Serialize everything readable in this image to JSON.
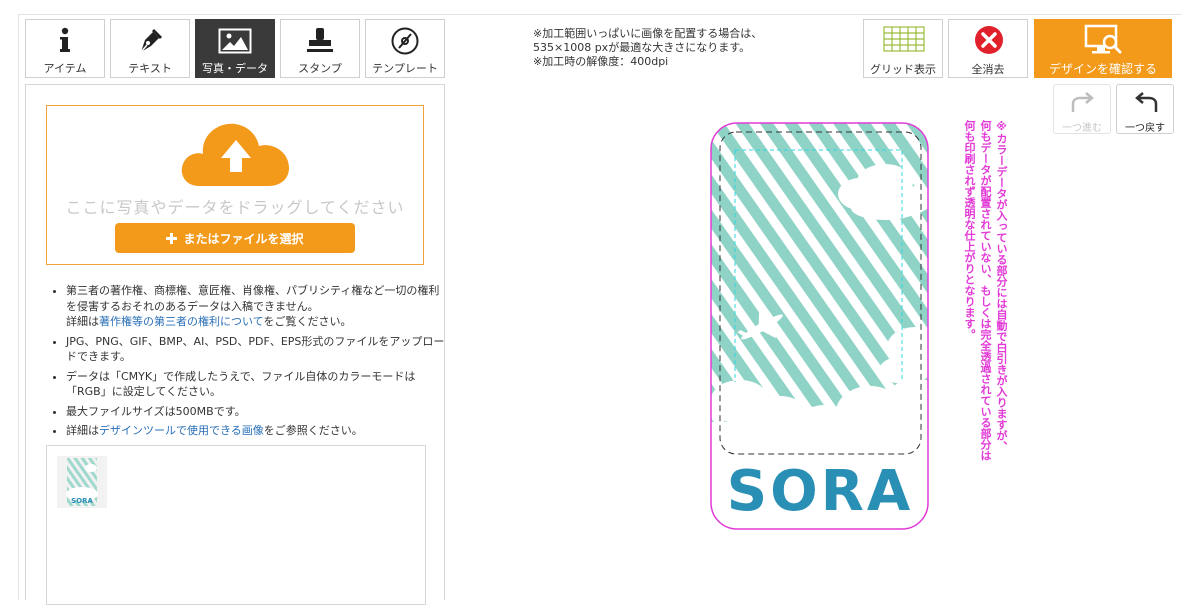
{
  "tabs": [
    {
      "label": "アイテム",
      "icon": "info-icon"
    },
    {
      "label": "テキスト",
      "icon": "pen-nib-icon"
    },
    {
      "label": "写真・データ",
      "icon": "image-icon"
    },
    {
      "label": "スタンプ",
      "icon": "stamp-icon"
    },
    {
      "label": "テンプレート",
      "icon": "template-icon"
    }
  ],
  "active_tab": "写真・データ",
  "upload": {
    "drop_text": "ここに写真やデータをドラッグしてください",
    "select_button": "またはファイルを選択"
  },
  "notes": {
    "n1_a": "第三者の著作権、商標権、意匠権、肖像権、パブリシティ権など一切の権利を侵害するおそれのあるデータは入稿できません。",
    "n1_b": "詳細は",
    "n1_link": "著作権等の第三者の権利について",
    "n1_c": "をご覧ください。",
    "n2": "JPG、PNG、GIF、BMP、AI、PSD、PDF、EPS形式のファイルをアップロードできます。",
    "n3": "データは「CMYK」で作成したうえで、ファイル自体のカラーモードは「RGB」に設定してください。",
    "n4": "最大ファイルサイズは500MBです。",
    "n5_a": "詳細は",
    "n5_link": "デザインツールで使用できる画像",
    "n5_b": "をご参照ください。"
  },
  "info": {
    "line1": "※加工範囲いっぱいに画像を配置する場合は、",
    "line2": "535×1008 pxが最適な大きさになります。",
    "line3": "※加工時の解像度：400dpi"
  },
  "toolbar": {
    "grid_label": "グリッド表示",
    "clear_label": "全消去",
    "confirm_label": "デザインを確認する",
    "redo_label": "一つ進む",
    "undo_label": "一つ戻す"
  },
  "canvas": {
    "design_text": "SORA",
    "thumb_text": "SORA"
  },
  "vertical_note": {
    "col1": "※カラーデータが入っている部分には自動で白引きが入りますが、",
    "col2": "何もデータが配置されていない、もしくは完全透過されている部分は",
    "col3": "何も印刷されず透明な仕上がりとなります。"
  },
  "colors": {
    "accent": "#f39a1b",
    "active_tab": "#3a3a3a",
    "note_magenta": "#e23ad6",
    "stripe": "#8fd3c7",
    "sora_text": "#2a8fb5",
    "clear_red": "#e0202a",
    "grid_green": "#9bbd3a"
  }
}
